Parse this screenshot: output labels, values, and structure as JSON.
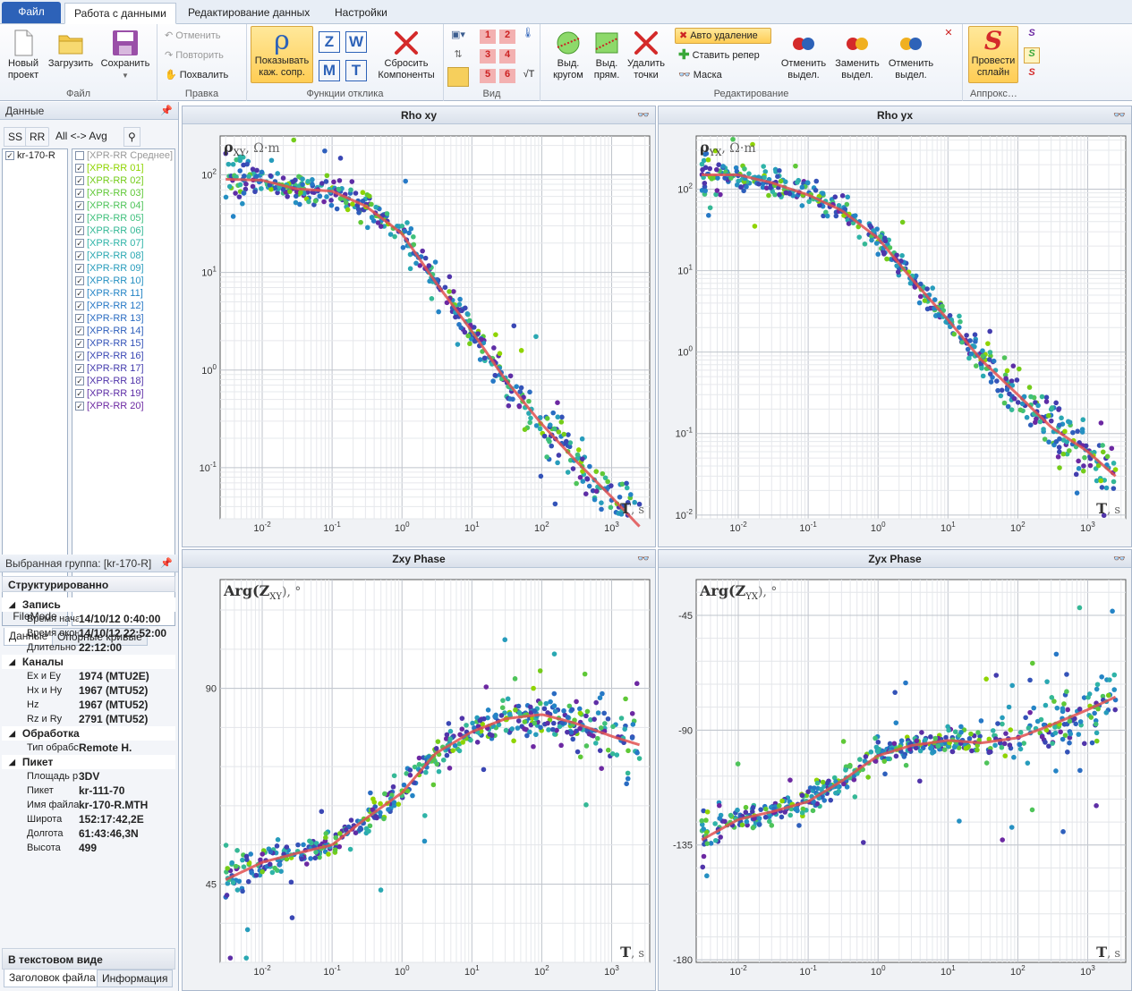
{
  "tabs": {
    "file": "Файл",
    "data": "Работа с данными",
    "edit": "Редактирование данных",
    "settings": "Настройки"
  },
  "ribbon": {
    "file": {
      "label": "Файл",
      "new": "Новый проект",
      "load": "Загрузить",
      "save": "Сохранить"
    },
    "edit": {
      "label": "Правка",
      "undo": "Отменить",
      "redo": "Повторить",
      "praise": "Похвалить"
    },
    "response": {
      "label": "Функции отклика",
      "show": "Показывать каж. сопр.",
      "reset": "Сбросить Компоненты",
      "z": "Z",
      "w": "W",
      "m": "M",
      "t": "T",
      "rho": "ρ"
    },
    "view": {
      "label": "Вид",
      "n1": "1",
      "n2": "2",
      "n3": "3",
      "n4": "4",
      "n5": "5",
      "n6": "6",
      "sqrt": "√T"
    },
    "editing": {
      "label": "Редактирование",
      "circle": "Выд. кругом",
      "rect": "Выд. прям.",
      "delete": "Удалить точки",
      "auto": "Авто удаление",
      "mark": "Ставить репер",
      "mask": "Маска",
      "cancel1": "Отменить выдел.",
      "replace": "Заменить выдел.",
      "cancel2": "Отменить выдел."
    },
    "approx": {
      "label": "Аппрокс…",
      "spline": "Провести сплайн",
      "s": "S"
    }
  },
  "left": {
    "data_title": "Данные",
    "ss": "SS",
    "rr": "RR",
    "allavg": "All <-> Avg",
    "site": "kr-170-R",
    "mean": "[XPR-RR Среднее]",
    "records": [
      {
        "name": "[XPR-RR 01]",
        "color": "#8fd400"
      },
      {
        "name": "[XPR-RR 02]",
        "color": "#74cc1a"
      },
      {
        "name": "[XPR-RR 03]",
        "color": "#5fc837"
      },
      {
        "name": "[XPR-RR 04]",
        "color": "#4fc45a"
      },
      {
        "name": "[XPR-RR 05]",
        "color": "#3fc07c"
      },
      {
        "name": "[XPR-RR 06]",
        "color": "#35b896"
      },
      {
        "name": "[XPR-RR 07]",
        "color": "#2fb4a8"
      },
      {
        "name": "[XPR-RR 08]",
        "color": "#2aa8b2"
      },
      {
        "name": "[XPR-RR 09]",
        "color": "#279cbc"
      },
      {
        "name": "[XPR-RR 10]",
        "color": "#2590c2"
      },
      {
        "name": "[XPR-RR 11]",
        "color": "#2484c6"
      },
      {
        "name": "[XPR-RR 12]",
        "color": "#2678c6"
      },
      {
        "name": "[XPR-RR 13]",
        "color": "#2a6cc2"
      },
      {
        "name": "[XPR-RR 14]",
        "color": "#2e5fbc"
      },
      {
        "name": "[XPR-RR 15]",
        "color": "#3453b8"
      },
      {
        "name": "[XPR-RR 16]",
        "color": "#3a47b4"
      },
      {
        "name": "[XPR-RR 17]",
        "color": "#433cae"
      },
      {
        "name": "[XPR-RR 18]",
        "color": "#5034aa"
      },
      {
        "name": "[XPR-RR 19]",
        "color": "#5e2ea6"
      },
      {
        "name": "[XPR-RR 20]",
        "color": "#6c28a2"
      }
    ],
    "filemode": "FileMode",
    "tab_data": "Данные",
    "tab_ref": "Опорные кривые",
    "group_title": "Выбранная группа: [kr-170-R]",
    "structured": "Структурированно",
    "props": [
      {
        "cat": "Запись",
        "rows": [
          [
            "Время нача",
            "14/10/12 0:40:00"
          ],
          [
            "Время окон",
            "14/10/12 22:52:00"
          ],
          [
            "Длительно",
            "22:12:00"
          ]
        ]
      },
      {
        "cat": "Каналы",
        "rows": [
          [
            "Ex и Ey",
            "1974 (MTU2E)"
          ],
          [
            "Hx и Hy",
            "1967 (MTU52)"
          ],
          [
            "Hz",
            "1967 (MTU52)"
          ],
          [
            "Rz и Ry",
            "2791 (MTU52)"
          ]
        ]
      },
      {
        "cat": "Обработка",
        "rows": [
          [
            "Тип обрабс",
            "Remote H."
          ]
        ]
      },
      {
        "cat": "Пикет",
        "rows": [
          [
            "Площадь р",
            "3DV"
          ],
          [
            "Пикет",
            "kr-111-70"
          ],
          [
            "Имя файла",
            "kr-170-R.MTH"
          ],
          [
            "Широта",
            "152:17:42,2E"
          ],
          [
            "Долгота",
            "61:43:46,3N"
          ],
          [
            "Высота",
            "499"
          ]
        ]
      }
    ],
    "text_view": "В текстовом виде",
    "tab_header": "Заголовок файла",
    "tab_info": "Информация"
  },
  "chart_data": [
    {
      "type": "scatter",
      "title": "Rho xy",
      "ylabel_main": "ρ",
      "ylabel_sub": "XY",
      "ylabel_unit": ", Ω·m",
      "xlabel": "T",
      "xunit": ", s",
      "xscale": "log",
      "yscale": "log",
      "xlim": [
        0.0025,
        3500
      ],
      "ylim": [
        0.03,
        250
      ],
      "xticks": [
        {
          "b": "10",
          "e": "-2",
          "v": 0.01
        },
        {
          "b": "10",
          "e": "-1",
          "v": 0.1
        },
        {
          "b": "10",
          "e": "0",
          "v": 1
        },
        {
          "b": "10",
          "e": "1",
          "v": 10
        },
        {
          "b": "10",
          "e": "2",
          "v": 100
        },
        {
          "b": "10",
          "e": "3",
          "v": 1000
        }
      ],
      "yticks": [
        {
          "b": "10",
          "e": "2",
          "v": 100
        },
        {
          "b": "10",
          "e": "1",
          "v": 10
        },
        {
          "b": "10",
          "e": "0",
          "v": 1
        },
        {
          "b": "10",
          "e": "-1",
          "v": 0.1
        }
      ],
      "spline": [
        [
          0.003,
          90
        ],
        [
          0.01,
          88
        ],
        [
          0.03,
          72
        ],
        [
          0.1,
          68
        ],
        [
          0.3,
          48
        ],
        [
          1,
          25
        ],
        [
          3,
          8
        ],
        [
          10,
          2.5
        ],
        [
          30,
          0.8
        ],
        [
          100,
          0.28
        ],
        [
          300,
          0.12
        ],
        [
          1000,
          0.05
        ],
        [
          2500,
          0.025
        ]
      ],
      "scatter": 0.12,
      "outlier_frac": 0.08
    },
    {
      "type": "scatter",
      "title": "Rho yx",
      "ylabel_main": "ρ",
      "ylabel_sub": "YX",
      "ylabel_unit": ", Ω·m",
      "xlabel": "T",
      "xunit": ", s",
      "xscale": "log",
      "yscale": "log",
      "xlim": [
        0.0025,
        3500
      ],
      "ylim": [
        0.009,
        450
      ],
      "xticks": [
        {
          "b": "10",
          "e": "-2",
          "v": 0.01
        },
        {
          "b": "10",
          "e": "-1",
          "v": 0.1
        },
        {
          "b": "10",
          "e": "0",
          "v": 1
        },
        {
          "b": "10",
          "e": "1",
          "v": 10
        },
        {
          "b": "10",
          "e": "2",
          "v": 100
        },
        {
          "b": "10",
          "e": "3",
          "v": 1000
        }
      ],
      "yticks": [
        {
          "b": "10",
          "e": "2",
          "v": 100
        },
        {
          "b": "10",
          "e": "1",
          "v": 10
        },
        {
          "b": "10",
          "e": "0",
          "v": 1
        },
        {
          "b": "10",
          "e": "-1",
          "v": 0.1
        },
        {
          "b": "10",
          "e": "-2",
          "v": 0.01
        }
      ],
      "spline": [
        [
          0.003,
          150
        ],
        [
          0.01,
          150
        ],
        [
          0.03,
          120
        ],
        [
          0.1,
          85
        ],
        [
          0.3,
          55
        ],
        [
          1,
          25
        ],
        [
          3,
          8
        ],
        [
          10,
          2.5
        ],
        [
          30,
          0.8
        ],
        [
          100,
          0.3
        ],
        [
          300,
          0.12
        ],
        [
          1000,
          0.06
        ],
        [
          2500,
          0.03
        ]
      ],
      "scatter": 0.13,
      "outlier_frac": 0.08
    },
    {
      "type": "scatter",
      "title": "Zxy Phase",
      "ylabel_main": "Arg(Z",
      "ylabel_sub": "XY",
      "ylabel_unit": "), °",
      "xlabel": "T",
      "xunit": ", s",
      "xscale": "log",
      "yscale": "linear",
      "xlim": [
        0.0025,
        3500
      ],
      "ylim": [
        27,
        115
      ],
      "xticks": [
        {
          "b": "10",
          "e": "-2",
          "v": 0.01
        },
        {
          "b": "10",
          "e": "-1",
          "v": 0.1
        },
        {
          "b": "10",
          "e": "0",
          "v": 1
        },
        {
          "b": "10",
          "e": "1",
          "v": 10
        },
        {
          "b": "10",
          "e": "2",
          "v": 100
        },
        {
          "b": "10",
          "e": "3",
          "v": 1000
        }
      ],
      "yticks": [
        {
          "b": "90",
          "e": "",
          "v": 90
        },
        {
          "b": "45",
          "e": "",
          "v": 45
        }
      ],
      "spline": [
        [
          0.003,
          46
        ],
        [
          0.01,
          50
        ],
        [
          0.03,
          52
        ],
        [
          0.1,
          54
        ],
        [
          0.3,
          60
        ],
        [
          1,
          66
        ],
        [
          3,
          75
        ],
        [
          10,
          80
        ],
        [
          30,
          83
        ],
        [
          100,
          84
        ],
        [
          300,
          82
        ],
        [
          1000,
          79
        ],
        [
          2500,
          77
        ]
      ],
      "scatter": 2.5,
      "outlier_frac": 0.1
    },
    {
      "type": "scatter",
      "title": "Zyx Phase",
      "ylabel_main": "Arg(Z",
      "ylabel_sub": "YX",
      "ylabel_unit": "), °",
      "xlabel": "T",
      "xunit": ", s",
      "xscale": "log",
      "yscale": "linear",
      "xlim": [
        0.0025,
        3500
      ],
      "ylim": [
        -181,
        -31
      ],
      "xticks": [
        {
          "b": "10",
          "e": "-2",
          "v": 0.01
        },
        {
          "b": "10",
          "e": "-1",
          "v": 0.1
        },
        {
          "b": "10",
          "e": "0",
          "v": 1
        },
        {
          "b": "10",
          "e": "1",
          "v": 10
        },
        {
          "b": "10",
          "e": "2",
          "v": 100
        },
        {
          "b": "10",
          "e": "3",
          "v": 1000
        }
      ],
      "yticks": [
        {
          "b": "-45",
          "e": "",
          "v": -45
        },
        {
          "b": "-90",
          "e": "",
          "v": -90
        },
        {
          "b": "-135",
          "e": "",
          "v": -135
        },
        {
          "b": "-180",
          "e": "",
          "v": -180
        }
      ],
      "spline": [
        [
          0.003,
          -133
        ],
        [
          0.01,
          -125
        ],
        [
          0.03,
          -122
        ],
        [
          0.1,
          -118
        ],
        [
          0.3,
          -110
        ],
        [
          1,
          -100
        ],
        [
          3,
          -96
        ],
        [
          10,
          -94
        ],
        [
          30,
          -95
        ],
        [
          100,
          -93
        ],
        [
          300,
          -88
        ],
        [
          1000,
          -82
        ],
        [
          2500,
          -77
        ]
      ],
      "scatter": 4,
      "outlier_frac": 0.1
    }
  ]
}
